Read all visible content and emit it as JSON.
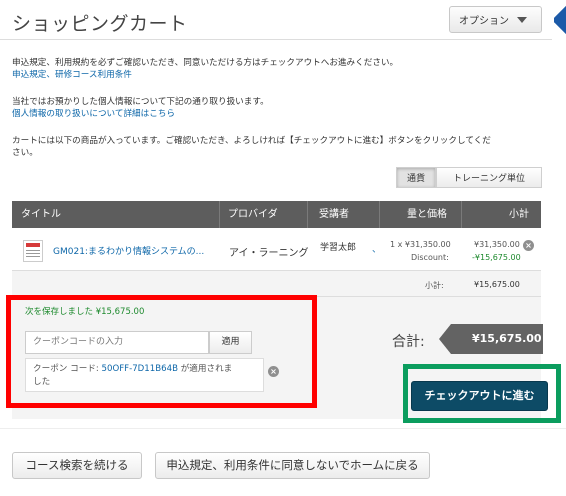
{
  "header": {
    "title": "ショッピングカート",
    "options_label": "オプション"
  },
  "notices": {
    "terms_text": "申込規定、利用規約を必ずご確認いただき、同意いただける方はチェックアウトへお進みください。",
    "terms_link": "申込規定、研修コース利用条件",
    "privacy_text": "当社ではお預かりした個人情報について下記の通り取り扱います。",
    "privacy_link": "個人情報の取り扱いについて詳細はこちら",
    "cart_text_1": "カートには以下の商品が入っています。ご確認いただき、よろしければ【チェックアウトに進む】ボタンをクリックしてくだ",
    "cart_text_2": "さい。"
  },
  "currency_toggle": {
    "currency": "通貨",
    "training_unit": "トレーニング単位"
  },
  "table": {
    "headers": {
      "title": "タイトル",
      "provider": "プロバイダ",
      "attendee": "受講者",
      "qty_price": "量と価格",
      "subtotal": "小計"
    },
    "rows": [
      {
        "title": "GM021:まるわかり情報システムの...",
        "provider": "アイ・ラーニング",
        "attendee": "学習太郎",
        "attendee_suffix": "、",
        "qty_price": "1 x ¥31,350.00",
        "discount_label": "Discount:",
        "subtotal": "¥31,350.00",
        "discount": "-¥15,675.00"
      }
    ],
    "subtotal_label": "小計:",
    "subtotal_value": "¥15,675.00"
  },
  "coupon": {
    "saved_text": "次を保存しました ¥15,675.00",
    "placeholder": "クーポンコードの入力",
    "apply_label": "適用",
    "applied_prefix": "クーポン コード:",
    "applied_code": "50OFF-7D11B64B",
    "applied_suffix": "が適用されま",
    "applied_suffix_2": "した"
  },
  "total": {
    "label": "合計:",
    "value": "¥15,675.00"
  },
  "checkout_label": "チェックアウトに進む",
  "footer": {
    "continue_label": "コース検索を続ける",
    "decline_label": "申込規定、利用条件に同意しないでホームに戻る"
  },
  "colors": {
    "link": "#0e67a9",
    "discount": "#1e8a2e",
    "checkout": "#0d4b66",
    "highlight_red": "#ff0000",
    "highlight_green": "#0b9d5e"
  }
}
